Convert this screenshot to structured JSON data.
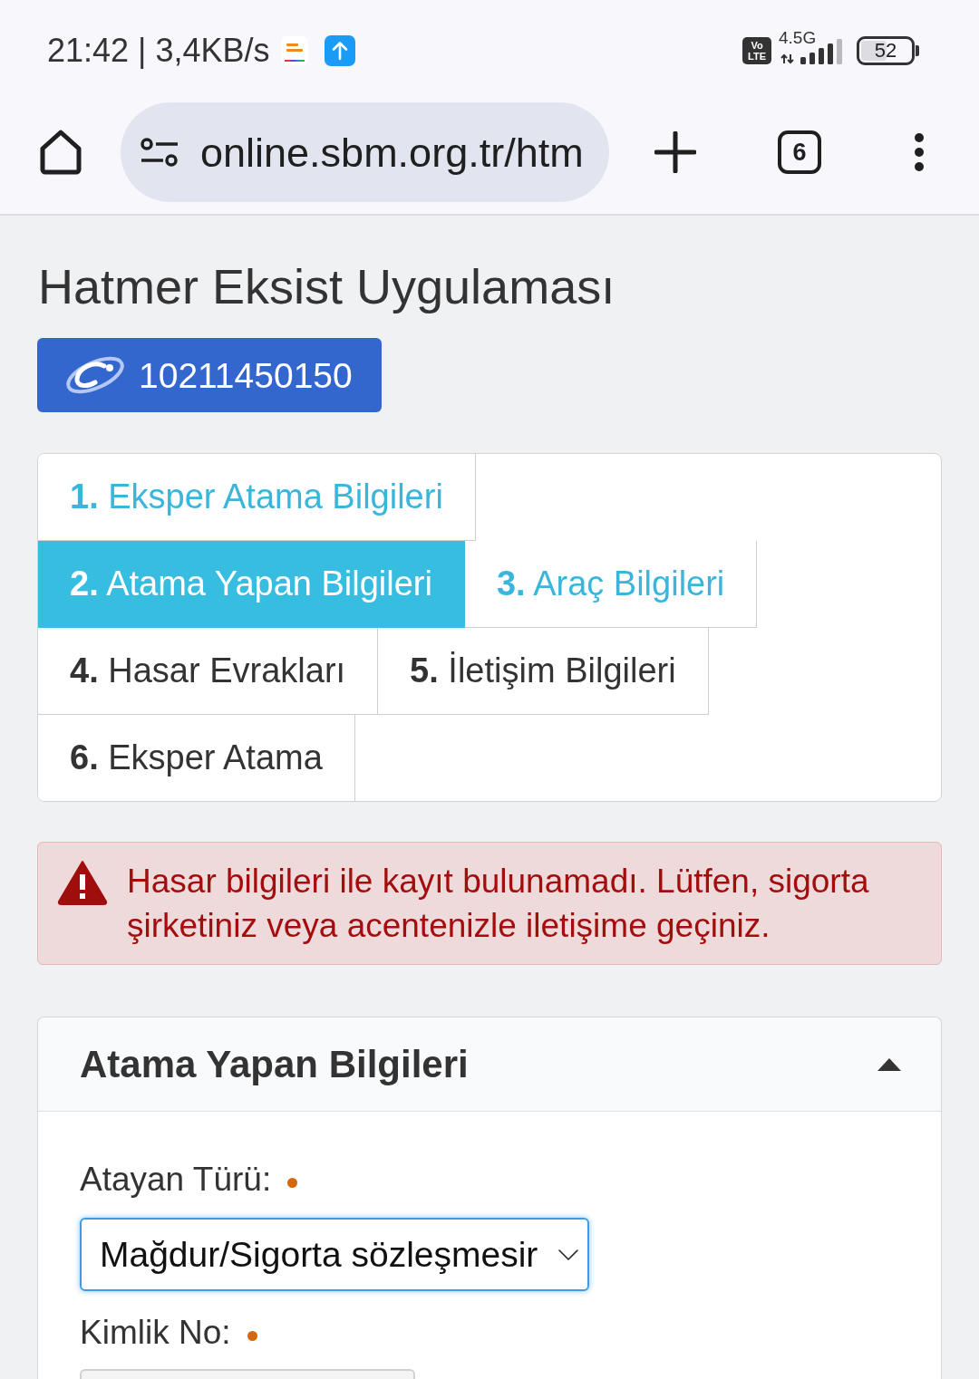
{
  "status_bar": {
    "time_and_speed": "21:42 | 3,4KB/s",
    "volte_badge": [
      "Vo",
      "LTE"
    ],
    "network_type": "4.5G",
    "battery": "52"
  },
  "browser_toolbar": {
    "url": "online.sbm.org.tr/htm",
    "tab_count": "6"
  },
  "page": {
    "title": "Hatmer Eksist Uygulaması",
    "id_button": "10211450150",
    "tabs": [
      {
        "label": "**1.** Eksper Atama Bilgileri",
        "selected": false,
        "disabled": false
      },
      {
        "label": "**2.** Atama Yapan Bilgileri",
        "selected": true,
        "disabled": false
      },
      {
        "label": "**3.** Araç Bilgileri",
        "selected": false,
        "disabled": false
      },
      {
        "label": "**4.** Hasar Evrakları",
        "selected": false,
        "disabled": true
      },
      {
        "label": "**5.** İletişim Bilgileri",
        "selected": false,
        "disabled": true
      },
      {
        "label": "**6.** Eksper Atama",
        "selected": false,
        "disabled": true
      }
    ],
    "alert": {
      "message": "Hasar bilgileri ile kayıt bulunamadı. Lütfen, sigorta şirketiniz veya acentenizle iletişime geçiniz."
    },
    "panel": {
      "title": "Atama Yapan Bilgileri",
      "expanded": true,
      "fields": [
        {
          "kind": "select",
          "label": "Atayan Türü:",
          "required": true,
          "value": "Mağdur/Sigorta sözleşmesir",
          "focused": true
        },
        {
          "kind": "text",
          "label": "Kimlik No:",
          "required": true,
          "focused": false
        }
      ]
    }
  }
}
